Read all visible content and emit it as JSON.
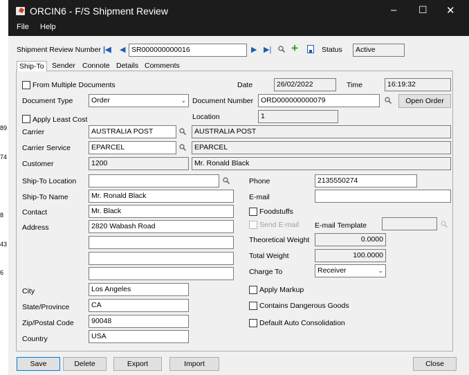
{
  "window": {
    "title": "ORCIN6 - F/S Shipment Review",
    "accent": "#1c1c1c",
    "controls": {
      "minimize": "–",
      "maximize": "☐",
      "close": "✕"
    }
  },
  "menu": {
    "file": "File",
    "help": "Help"
  },
  "nav": {
    "label": "Shipment Review Number",
    "value": "SR000000000016",
    "status_label": "Status",
    "status_value": "Active"
  },
  "tabs": [
    {
      "label": "Ship-To",
      "active": true
    },
    {
      "label": "Sender"
    },
    {
      "label": "Connote"
    },
    {
      "label": "Details"
    },
    {
      "label": "Comments"
    }
  ],
  "form": {
    "from_multiple_docs": "From Multiple Documents",
    "date_label": "Date",
    "date_value": "26/02/2022",
    "time_label": "Time",
    "time_value": "16:19:32",
    "doc_type_label": "Document Type",
    "doc_type_value": "Order",
    "doc_number_label": "Document Number",
    "doc_number_value": "ORD000000000079",
    "open_order": "Open Order",
    "apply_least_cost": "Apply Least Cost",
    "location_label": "Location",
    "location_value": "1",
    "carrier_label": "Carrier",
    "carrier_value": "AUSTRALIA POST",
    "carrier_desc": "AUSTRALIA POST",
    "carrier_service_label": "Carrier Service",
    "carrier_service_value": "EPARCEL",
    "carrier_service_desc": "EPARCEL",
    "customer_label": "Customer",
    "customer_value": "1200",
    "customer_desc": "Mr. Ronald Black",
    "shipto_location_label": "Ship-To Location",
    "shipto_location_value": "",
    "shipto_name_label": "Ship-To Name",
    "shipto_name_value": "Mr. Ronald Black",
    "contact_label": "Contact",
    "contact_value": "Mr. Black",
    "address_label": "Address",
    "address_lines": [
      "2820 Wabash Road",
      "",
      "",
      ""
    ],
    "city_label": "City",
    "city_value": "Los Angeles",
    "state_label": "State/Province",
    "state_value": "CA",
    "zip_label": "Zip/Postal Code",
    "zip_value": "90048",
    "country_label": "Country",
    "country_value": "USA",
    "phone_label": "Phone",
    "phone_value": "2135550274",
    "email_label": "E-mail",
    "email_value": "",
    "foodstuffs": "Foodstuffs",
    "send_email": "Send E-mail",
    "email_template_label": "E-mail Template",
    "email_template_value": "",
    "theoretical_weight_label": "Theoretical Weight",
    "theoretical_weight_value": "0.0000",
    "total_weight_label": "Total Weight",
    "total_weight_value": "100.0000",
    "charge_to_label": "Charge To",
    "charge_to_value": "Receiver",
    "apply_markup": "Apply Markup",
    "dangerous_goods": "Contains Dangerous Goods",
    "auto_consolidation": "Default Auto Consolidation"
  },
  "footer": {
    "save": "Save",
    "delete": "Delete",
    "export": "Export",
    "import": "Import",
    "close": "Close"
  },
  "margin_labels": [
    "89",
    "74",
    "8",
    "43",
    "6"
  ]
}
